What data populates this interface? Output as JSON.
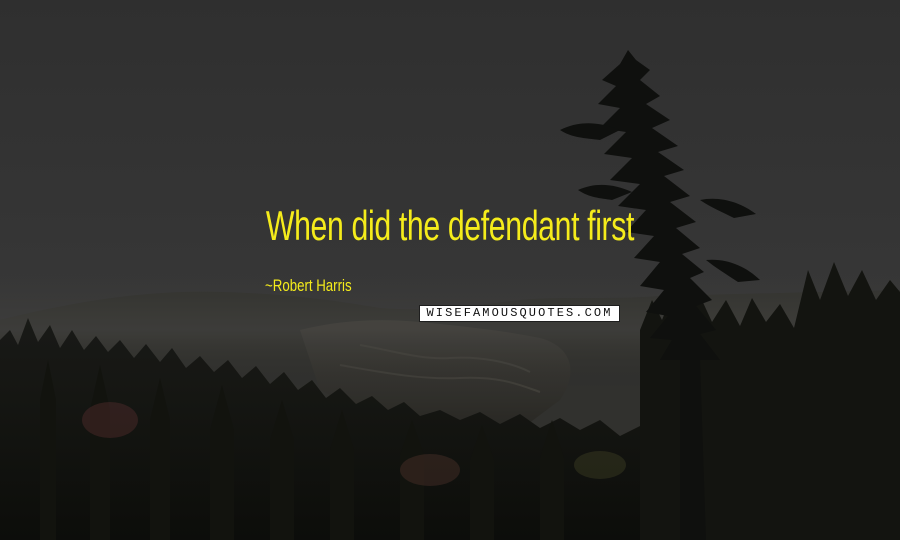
{
  "quote": {
    "text": "When did the defendant first",
    "author": "Robert Harris",
    "color": "#f5ec1b"
  },
  "watermark": {
    "text": "WISEFAMOUSQUOTES.COM"
  },
  "background": {
    "description_colors": {
      "sky": "#3a3a3a",
      "forest": "#141612"
    }
  }
}
